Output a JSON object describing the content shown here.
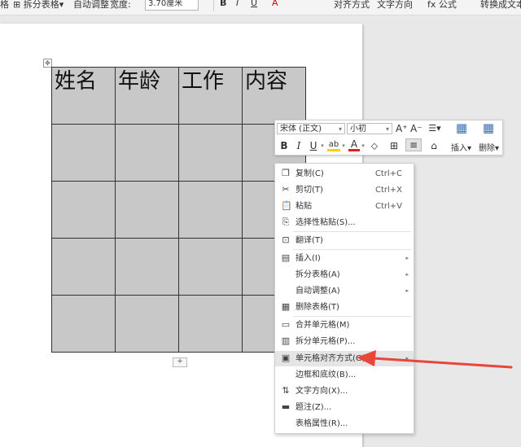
{
  "ribbon": {
    "split_table": "拆分表格",
    "auto_fit": "自动调整",
    "width_label": "宽度:",
    "width_value": "3.70厘米",
    "bold": "B",
    "italic": "I",
    "underline": "U",
    "font_color": "A",
    "align": "对齐方式",
    "text_dir": "文字方向",
    "formula": "fx 公式",
    "convert": "转换成文本"
  },
  "table": {
    "headers": [
      "姓名",
      "年龄",
      "工作",
      "内容"
    ],
    "rows": 5,
    "cell_color": "#c8c8c8"
  },
  "mini_toolbar": {
    "font": "宋体 (正文)",
    "size": "小初",
    "grow": "A⁺",
    "shrink": "A⁻",
    "bold": "B",
    "italic": "I",
    "underline": "U",
    "highlight": "ab",
    "font_color": "A",
    "insert": "插入",
    "delete": "删除"
  },
  "context_menu": {
    "items": [
      {
        "label": "复制(C)",
        "shortcut": "Ctrl+C",
        "icon": "copy-icon"
      },
      {
        "label": "剪切(T)",
        "shortcut": "Ctrl+X",
        "icon": "scissors-icon"
      },
      {
        "label": "粘贴",
        "shortcut": "Ctrl+V",
        "icon": "paste-icon"
      },
      {
        "label": "选择性粘贴(S)...",
        "shortcut": "",
        "icon": "paste-special-icon"
      },
      {
        "label": "翻译(T)",
        "shortcut": "",
        "icon": "translate-icon"
      },
      {
        "label": "插入(I)",
        "shortcut": "",
        "icon": "table-insert-icon"
      },
      {
        "label": "拆分表格(A)",
        "shortcut": "",
        "icon": ""
      },
      {
        "label": "自动调整(A)",
        "shortcut": "",
        "icon": ""
      },
      {
        "label": "删除表格(T)",
        "shortcut": "",
        "icon": "table-delete-icon"
      },
      {
        "label": "合并单元格(M)",
        "shortcut": "",
        "icon": "merge-cells-icon"
      },
      {
        "label": "拆分单元格(P)...",
        "shortcut": "",
        "icon": "split-cells-icon"
      },
      {
        "label": "单元格对齐方式(G)",
        "shortcut": "",
        "icon": "cell-align-icon"
      },
      {
        "label": "边框和底纹(B)...",
        "shortcut": "",
        "icon": ""
      },
      {
        "label": "文字方向(X)...",
        "shortcut": "",
        "icon": "text-direction-icon"
      },
      {
        "label": "题注(Z)...",
        "shortcut": "",
        "icon": "caption-icon"
      },
      {
        "label": "表格属性(R)...",
        "shortcut": "",
        "icon": ""
      }
    ]
  },
  "colors": {
    "arrow": "#e8463a",
    "highlight": "#e5e5e5"
  }
}
